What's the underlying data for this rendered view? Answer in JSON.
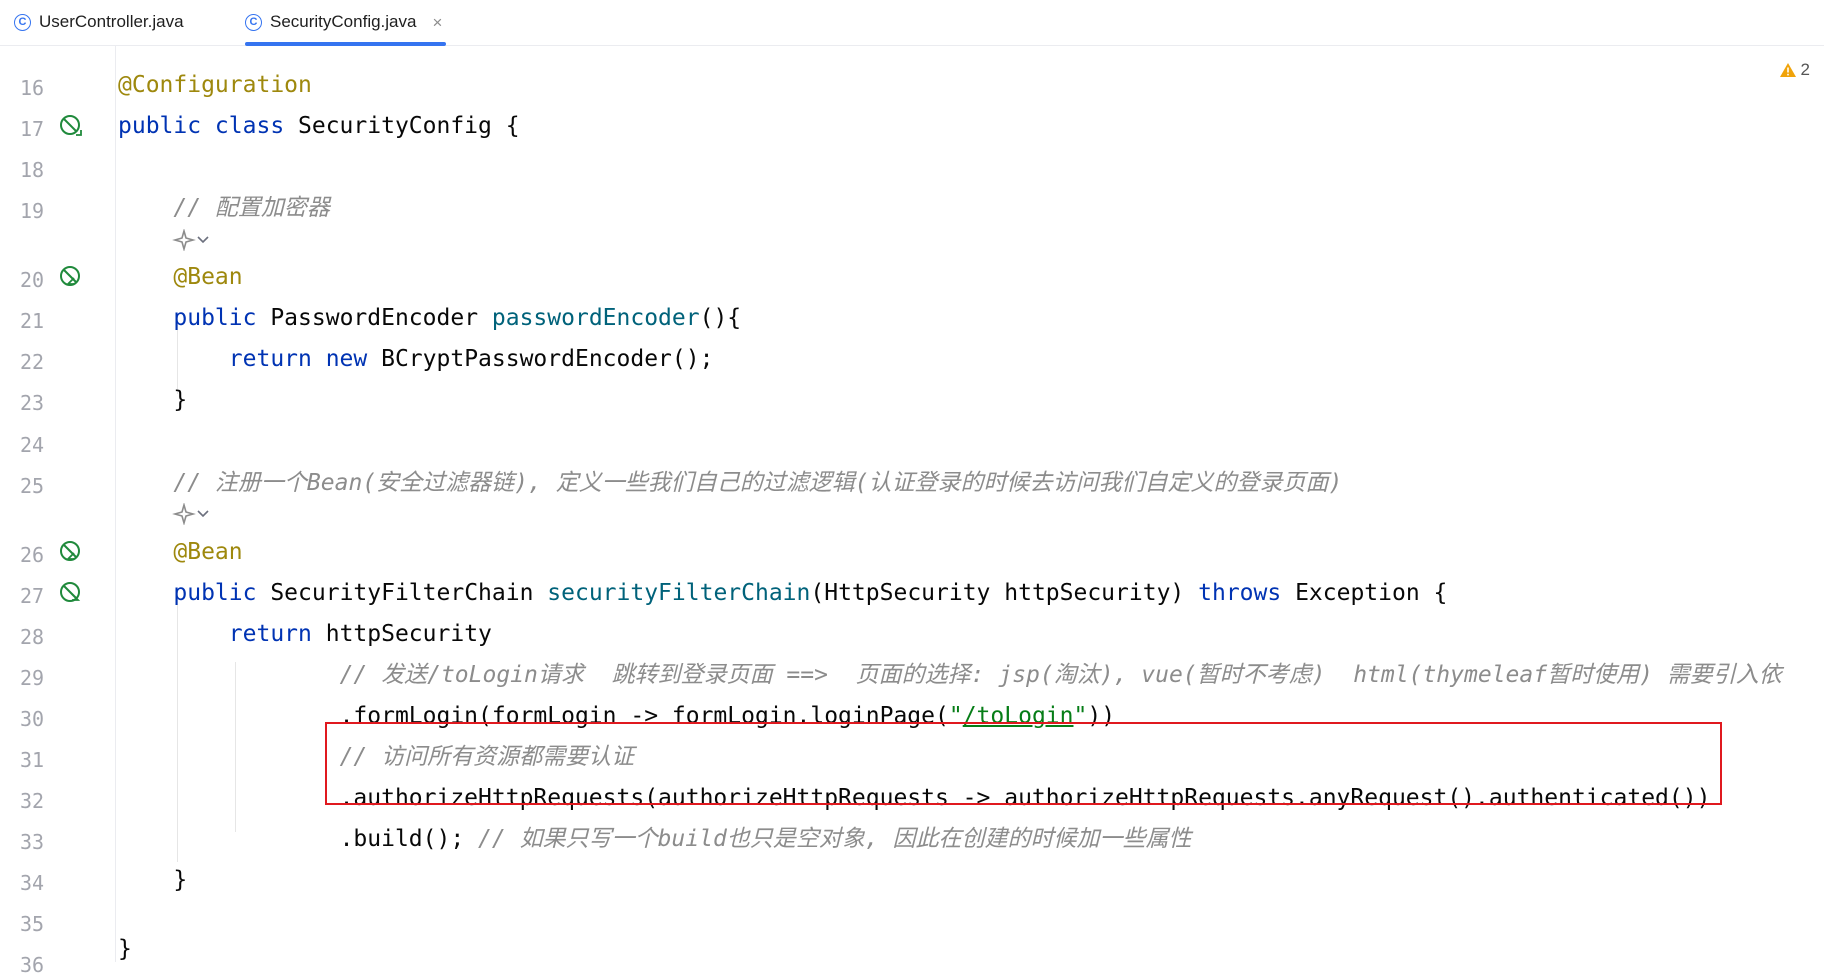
{
  "tabs": [
    {
      "label": "UserController.java",
      "icon": "class-icon",
      "active": false
    },
    {
      "label": "SecurityConfig.java",
      "icon": "class-icon",
      "active": true
    }
  ],
  "tab_close_glyph": "×",
  "class_icon_glyph": "C",
  "inspection": {
    "count": "2",
    "icon": "warning-triangle-icon",
    "color": "#f0a30a"
  },
  "line_numbers": [
    "16",
    "17",
    "18",
    "19",
    "20",
    "21",
    "22",
    "23",
    "24",
    "25",
    "26",
    "27",
    "28",
    "29",
    "30",
    "31",
    "32",
    "33",
    "34",
    "35",
    "36"
  ],
  "code": {
    "l16": {
      "annotation": "@Configuration"
    },
    "l17": {
      "kw": "public class",
      "rest": " SecurityConfig {"
    },
    "l19": {
      "comment": "// 配置加密器"
    },
    "l20": {
      "annotation": "@Bean"
    },
    "l21": {
      "kw": "public",
      "type": " PasswordEncoder ",
      "method": "passwordEncoder",
      "rest": "(){"
    },
    "l22": {
      "kw": "return new",
      "rest": " BCryptPasswordEncoder();"
    },
    "l23": {
      "text": "}"
    },
    "l25": {
      "comment": "// 注册一个Bean(安全过滤器链), 定义一些我们自己的过滤逻辑(认证登录的时候去访问我们自定义的登录页面)"
    },
    "l26": {
      "annotation": "@Bean"
    },
    "l27": {
      "kw": "public",
      "type": " SecurityFilterChain ",
      "method": "securityFilterChain",
      "params": "(HttpSecurity httpSecurity) ",
      "throws": "throws",
      "rest": " Exception {"
    },
    "l28": {
      "kw": "return",
      "rest": " httpSecurity"
    },
    "l29": {
      "comment": "// 发送/toLogin请求  跳转到登录页面 ==>  页面的选择: jsp(淘汰), vue(暂时不考虑)  html(thymeleaf暂时使用) 需要引入依"
    },
    "l30": {
      "pre": ".formLogin(formLogin -> formLogin.loginPage(",
      "quote": "\"",
      "string": "/toLogin",
      "post": "))"
    },
    "l31": {
      "comment": "// 访问所有资源都需要认证"
    },
    "l32": {
      "text": ".authorizeHttpRequests(authorizeHttpRequests -> authorizeHttpRequests.anyRequest().authenticated())"
    },
    "l33": {
      "text": ".build(); ",
      "comment": "// 如果只写一个build也只是空对象, 因此在创建的时候加一些属性"
    },
    "l34": {
      "text": "}"
    },
    "l36": {
      "text": "}"
    }
  },
  "gutter_icons": {
    "l17": "bean-config-icon",
    "l20": "bean-method-icon",
    "l26": "bean-method-icon",
    "l27": "bean-method-icon"
  },
  "inlay_hints": {
    "l19": "ai-actions-icon",
    "l25": "ai-actions-icon"
  },
  "colors": {
    "keyword": "#0033b3",
    "annotation": "#9e880d",
    "comment": "#8c8c8c",
    "method": "#00627a",
    "string": "#067d17",
    "highlight_box": "#e0191f",
    "tab_accent": "#3574f0"
  }
}
